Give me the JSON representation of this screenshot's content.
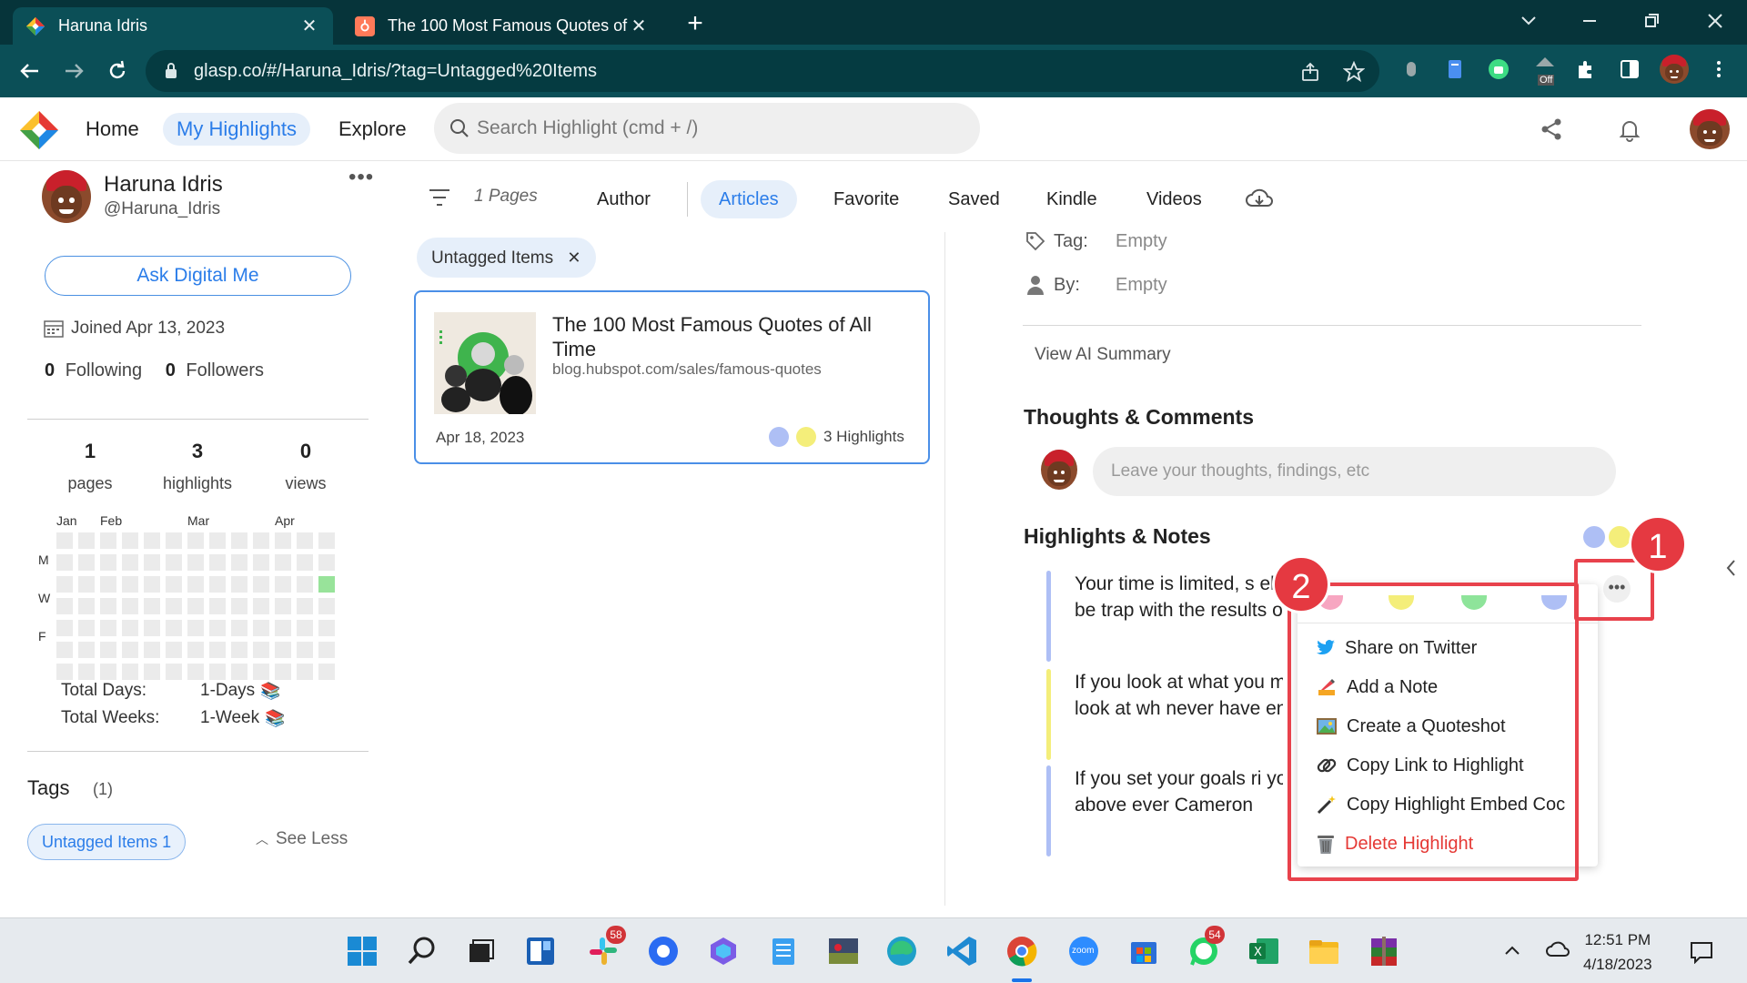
{
  "browser": {
    "tabs": [
      {
        "title": "Haruna Idris",
        "active": true
      },
      {
        "title": "The 100 Most Famous Quotes of",
        "active": false
      }
    ],
    "url": "glasp.co/#/Haruna_Idris/?tag=Untagged%20Items",
    "extension_off_label": "Off"
  },
  "header": {
    "nav": {
      "home": "Home",
      "my_highlights": "My Highlights",
      "explore": "Explore"
    },
    "search_placeholder": "Search Highlight (cmd + /)"
  },
  "profile": {
    "name": "Haruna Idris",
    "handle": "@Haruna_Idris",
    "more": "•••",
    "ask_button": "Ask Digital Me",
    "joined": "Joined Apr 13, 2023",
    "following_count": "0",
    "following_label": "Following",
    "followers_count": "0",
    "followers_label": "Followers",
    "stats": [
      {
        "value": "1",
        "label": "pages"
      },
      {
        "value": "3",
        "label": "highlights"
      },
      {
        "value": "0",
        "label": "views"
      }
    ],
    "months": [
      "Jan",
      "Feb",
      "Mar",
      "Apr"
    ],
    "weekdays": [
      "M",
      "W",
      "F"
    ],
    "total_days_label": "Total Days:",
    "total_days_value": "1-Days",
    "total_weeks_label": "Total Weeks:",
    "total_weeks_value": "1-Week",
    "tags_title": "Tags",
    "tags_count": "(1)",
    "tag_chip": "Untagged Items 1",
    "see_less": "See Less"
  },
  "filters": {
    "pages_count": "1 Pages",
    "tabs": [
      "Author",
      "Articles",
      "Favorite",
      "Saved",
      "Kindle",
      "Videos"
    ],
    "active_tab": "Articles",
    "active_chip": "Untagged Items"
  },
  "card": {
    "title": "The 100 Most Famous Quotes of All Time",
    "url": "blog.hubspot.com/sales/famous-quotes",
    "date": "Apr 18, 2023",
    "highlights": "3 Highlights",
    "dot_colors": [
      "#aebff5",
      "#f4ee7a"
    ]
  },
  "article": {
    "tag_label": "Tag:",
    "tag_value": "Empty",
    "by_label": "By:",
    "by_value": "Empty",
    "ai_summary": "View AI Summary",
    "thoughts_title": "Thoughts & Comments",
    "comment_placeholder": "Leave your thoughts, findings, etc",
    "highlights_title": "Highlights & Notes",
    "highlights": [
      {
        "text": "Your time is limited, s else's life. Don't be trap with the results of othe",
        "color": "#aebff5"
      },
      {
        "text": "If you look at what you more. If you look at wh never have enough. -O",
        "color": "#f4ee7a"
      },
      {
        "text": "If you set your goals ri you will fail above ever Cameron",
        "color": "#aebff5"
      }
    ]
  },
  "context_menu": {
    "color_swatches": [
      "#f7a6c1",
      "#f4ee7a",
      "#8ee49a",
      "#aebff5"
    ],
    "items": [
      {
        "label": "Share on Twitter",
        "icon": "twitter-icon"
      },
      {
        "label": "Add a Note",
        "icon": "pencil-icon"
      },
      {
        "label": "Create a Quoteshot",
        "icon": "picture-icon"
      },
      {
        "label": "Copy Link to Highlight",
        "icon": "link-icon"
      },
      {
        "label": "Copy Highlight Embed Coc",
        "icon": "wand-icon"
      },
      {
        "label": "Delete Highlight",
        "icon": "trash-icon"
      }
    ],
    "more_button": "•••"
  },
  "annotations": {
    "step1": "1",
    "step2": "2",
    "frame_color": "#e8424c"
  },
  "taskbar": {
    "slack_badge": "58",
    "whatsapp_badge": "54",
    "zoom_label": "zoom",
    "time": "12:51 PM",
    "date": "4/18/2023"
  }
}
